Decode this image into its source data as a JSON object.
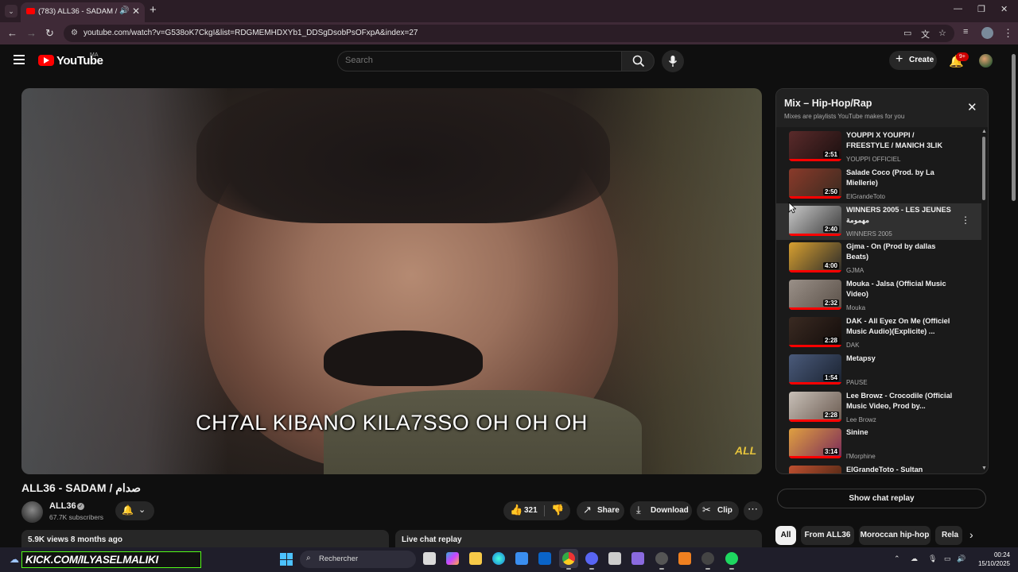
{
  "browser": {
    "tab_title": "(783) ALL36 - SADAM / صدام",
    "tab_audio_icon": "speaker-icon",
    "new_tab_label": "+",
    "url": "youtube.com/watch?v=G538oK7CkgI&list=RDGMEMHDXYb1_DDSgDsobPsOFxpA&index=27",
    "window_controls": [
      "—",
      "❐",
      "✕"
    ]
  },
  "header": {
    "logo_text": "YouTube",
    "country_code": "MA",
    "search_placeholder": "Search",
    "create_label": "Create",
    "notification_count": "9+"
  },
  "video": {
    "caption": "CH7AL KIBANO KILA7SSO OH OH OH",
    "watermark": "ALL",
    "title": "ALL36 - SADAM / صدام",
    "channel_name": "ALL36",
    "channel_subscribers": "67.7K subscribers",
    "likes": "321",
    "share_label": "Share",
    "download_label": "Download",
    "clip_label": "Clip",
    "views_and_date": "5.9K views  8 months ago",
    "live_chat_label": "Live chat replay"
  },
  "playlist": {
    "title": "Mix – Hip-Hop/Rap",
    "subtitle": "Mixes are playlists YouTube makes for you",
    "items": [
      {
        "title": "YOUPPI X YOUPPI / FREESTYLE / MANICH 3LIK",
        "channel": "YOUPPI OFFICIEL",
        "duration": "2:51",
        "colors": [
          "#5a2a2a",
          "#1a1010"
        ]
      },
      {
        "title": "Salade Coco (Prod. by La Miellerie)",
        "channel": "ElGrandeToto",
        "duration": "2:50",
        "colors": [
          "#8a3a2a",
          "#3a2a20"
        ]
      },
      {
        "title": "WINNERS 2005 - LES JEUNES مهمومة",
        "channel": "WINNERS 2005",
        "duration": "2:40",
        "colors": [
          "#c8c8c8",
          "#3a3a3a"
        ]
      },
      {
        "title": "Gjma - On (Prod by dallas Beats)",
        "channel": "GJMA",
        "duration": "4:00",
        "colors": [
          "#d8a030",
          "#2a2a2a"
        ]
      },
      {
        "title": "Mouka - Jalsa (Official Music Video)",
        "channel": "Mouka",
        "duration": "2:32",
        "colors": [
          "#9a9088",
          "#5a5048"
        ]
      },
      {
        "title": "DAK - All Eyez On Me (Officiel Music Audio)(Explicite) ...",
        "channel": "DAK",
        "duration": "2:28",
        "colors": [
          "#3a2a22",
          "#120c0a"
        ]
      },
      {
        "title": "Metapsy",
        "channel": "PAUSE",
        "duration": "1:54",
        "colors": [
          "#4a5a7a",
          "#1a2230"
        ]
      },
      {
        "title": "Lee Browz - Crocodile (Official Music Video, Prod by...",
        "channel": "Lee Browz",
        "duration": "2:28",
        "colors": [
          "#c8c0b8",
          "#6a5a50"
        ]
      },
      {
        "title": "Sinine",
        "channel": "l'Morphine",
        "duration": "3:14",
        "colors": [
          "#e0a040",
          "#7a2a5a"
        ]
      },
      {
        "title": "ElGrandeToto - Sultan #PlanèteRap",
        "channel": "",
        "duration": "",
        "colors": [
          "#c05030",
          "#3a2010"
        ]
      }
    ],
    "active_index": 2,
    "more_icon": "more-vert-icon"
  },
  "chat_replay_label": "Show chat replay",
  "chips": [
    "All",
    "From ALL36",
    "Moroccan hip-hop",
    "Rela"
  ],
  "taskbar": {
    "kick_text": "KICK.COM/ILYASELMALIKI",
    "search_label": "Rechercher",
    "time": "00:24",
    "date": "15/10/2025"
  },
  "colors": {
    "accent_red": "#ff0000",
    "background": "#0f0f0f",
    "kick_green": "#53fc18"
  }
}
